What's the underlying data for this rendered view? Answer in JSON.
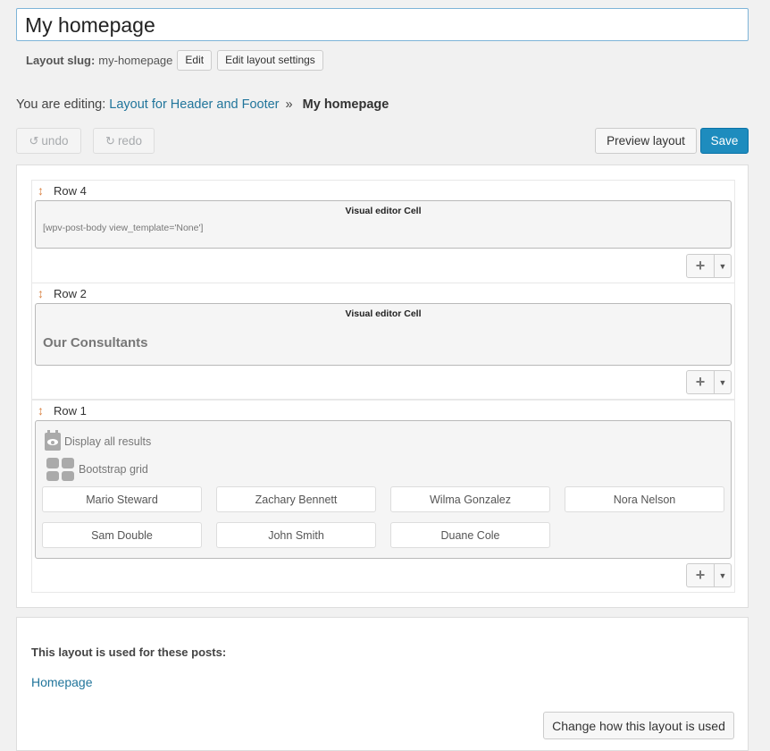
{
  "layout": {
    "title": "My homepage",
    "slug_label": "Layout slug:",
    "slug_value": "my-homepage",
    "edit_label": "Edit",
    "edit_settings_label": "Edit layout settings"
  },
  "breadcrumb": {
    "prefix": "You are editing:",
    "parent_link": "Layout for Header and Footer",
    "separator": "»",
    "current": "My homepage"
  },
  "toolbar": {
    "undo_icon": "↺",
    "undo_label": "undo",
    "redo_icon": "↻",
    "redo_label": "redo",
    "preview_label": "Preview layout",
    "save_label": "Save"
  },
  "rows": [
    {
      "label": "Row 4",
      "cell_title": "Visual editor Cell",
      "content": "[wpv-post-body view_template='None']"
    },
    {
      "label": "Row 2",
      "cell_title": "Visual editor Cell",
      "content": "Our Consultants"
    },
    {
      "label": "Row 1",
      "view_label": "Display all results",
      "grid_label": "Bootstrap grid",
      "items": [
        "Mario Steward",
        "Zachary Bennett",
        "Wilma Gonzalez",
        "Nora Nelson",
        "Sam Double",
        "John Smith",
        "Duane Cole"
      ]
    }
  ],
  "row_controls": {
    "add_icon": "+",
    "caret_icon": "▼",
    "drag_icon": "↕"
  },
  "usage": {
    "title": "This layout is used for these posts:",
    "link": "Homepage",
    "change_label": "Change how this layout is used"
  },
  "colors": {
    "link": "#21759b",
    "primary": "#1e8cbe",
    "drag_handle": "#d98446"
  }
}
